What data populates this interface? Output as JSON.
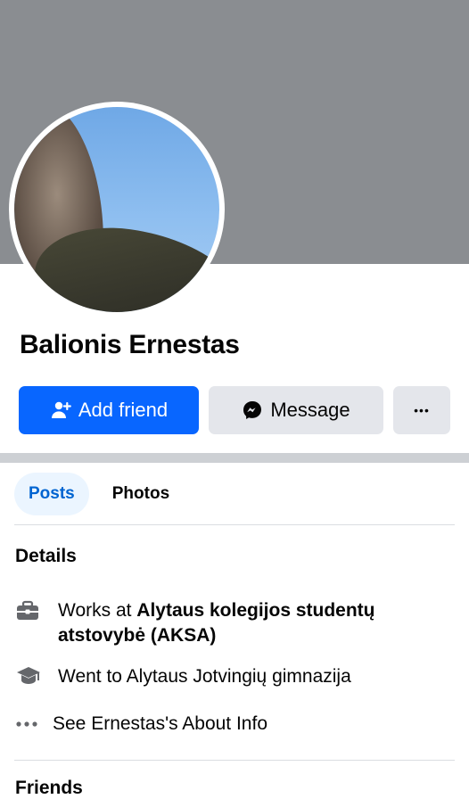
{
  "profile": {
    "name": "Balionis Ernestas"
  },
  "actions": {
    "add_friend": "Add friend",
    "message": "Message",
    "more": "•••"
  },
  "tabs": [
    {
      "label": "Posts",
      "active": true
    },
    {
      "label": "Photos",
      "active": false
    }
  ],
  "details": {
    "title": "Details",
    "work_prefix": "Works at ",
    "work_place": "Alytaus kolegijos studentų atstovybė (AKSA)",
    "education": "Went to Alytaus Jotvingių gimnazija",
    "about_link": "See Ernestas's About Info",
    "icons": [
      "briefcase-icon",
      "graduation-cap-icon",
      "more-dots-icon"
    ]
  },
  "friends": {
    "title": "Friends"
  },
  "colors": {
    "cover": "#8a8d91",
    "primary": "#0866ff",
    "secondary_button": "#e4e6eb",
    "tab_active_bg": "#ebf5ff",
    "tab_active_text": "#0064d1"
  }
}
